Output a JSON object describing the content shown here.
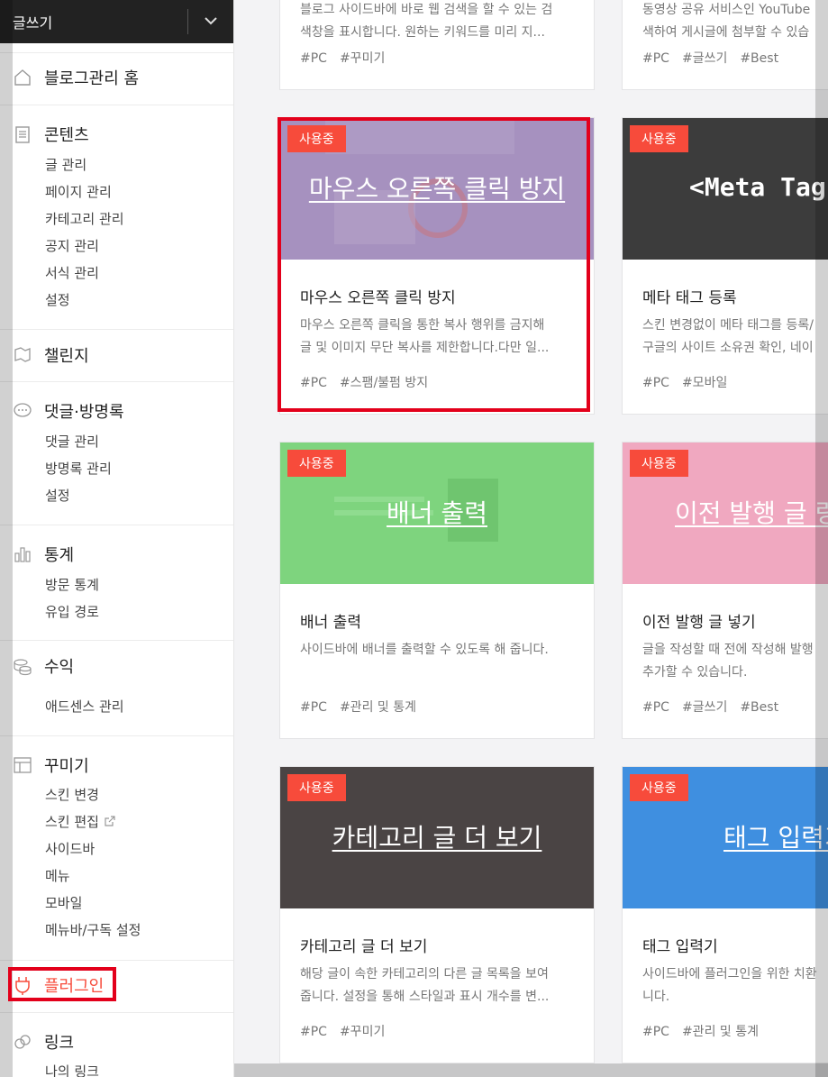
{
  "header": {
    "write_label": "글쓰기"
  },
  "sidebar": {
    "home": "블로그관리 홈",
    "contents": {
      "title": "콘텐츠",
      "items": [
        "글 관리",
        "페이지 관리",
        "카테고리 관리",
        "공지 관리",
        "서식 관리",
        "설정"
      ]
    },
    "challenge": "챌린지",
    "comments": {
      "title": "댓글·방명록",
      "items": [
        "댓글 관리",
        "방명록 관리",
        "설정"
      ]
    },
    "stats": {
      "title": "통계",
      "items": [
        "방문 통계",
        "유입 경로"
      ]
    },
    "revenue": {
      "title": "수익",
      "items": [
        "애드센스 관리"
      ]
    },
    "decorate": {
      "title": "꾸미기",
      "items": [
        "스킨 변경",
        "스킨 편집",
        "사이드바",
        "메뉴",
        "모바일",
        "메뉴바/구독 설정"
      ]
    },
    "plugin": "플러그인",
    "link": {
      "title": "링크",
      "items": [
        "나의 링크"
      ]
    }
  },
  "badge_label": "사용중",
  "cards": {
    "top_left": {
      "desc_line1": "블로그 사이드바에 바로 웹 검색을 할 수 있는 검",
      "desc_line2": "색창을 표시합니다. 원하는 키워드를 미리 지...",
      "tags": [
        "#PC",
        "#꾸미기"
      ]
    },
    "top_right": {
      "desc_line1": "동영상 공유 서비스인 YouTube",
      "desc_line2": "색하여 게시글에 첨부할 수 있습",
      "tags": [
        "#PC",
        "#글쓰기",
        "#Best"
      ]
    },
    "mouse": {
      "thumb": "마우스 오른쪽 클릭 방지",
      "title": "마우스 오른쪽 클릭 방지",
      "desc_line1": "마우스 오른쪽 클릭을 통한 복사 행위를 금지해",
      "desc_line2": "글 및 이미지 무단 복사를 제한합니다.다만 일...",
      "tags": [
        "#PC",
        "#스팸/불펌 방지"
      ]
    },
    "meta": {
      "thumb": "<Meta Tag",
      "title": "메타 태그 등록",
      "desc_line1": "스킨 변경없이 메타 태그를 등록/",
      "desc_line2": "구글의 사이트 소유권 확인, 네이",
      "tags": [
        "#PC",
        "#모바일"
      ]
    },
    "banner": {
      "thumb": "배너 출력",
      "title": "배너 출력",
      "desc_line1": "사이드바에 배너를 출력할 수 있도록 해 줍니다.",
      "tags": [
        "#PC",
        "#관리 및 통계"
      ]
    },
    "prev": {
      "thumb": "이전 발행 글 링크",
      "title": "이전 발행 글 넣기",
      "desc_line1": "글을 작성할 때 전에 작성해 발행",
      "desc_line2": "추가할 수 있습니다.",
      "tags": [
        "#PC",
        "#글쓰기",
        "#Best"
      ]
    },
    "category": {
      "thumb": "카테고리 글 더 보기",
      "title": "카테고리 글 더 보기",
      "desc_line1": "해당 글이 속한 카테고리의 다른 글 목록을 보여",
      "desc_line2": "줍니다. 설정을 통해 스타일과 표시 개수를 변...",
      "tags": [
        "#PC",
        "#꾸미기"
      ]
    },
    "tag": {
      "thumb": "태그 입력기",
      "title": "태그 입력기",
      "desc_line1": "사이드바에 플러그인을 위한 치환",
      "desc_line2": "니다.",
      "tags": [
        "#PC",
        "#관리 및 통계"
      ]
    }
  },
  "colors": {
    "accent": "#f74b3b",
    "highlight": "#e3001b",
    "mouse_thumb": "#a691bf",
    "meta_thumb": "#3c3c3c",
    "banner_thumb": "#7ed47e",
    "prev_thumb": "#f0a8c0",
    "category_thumb": "#4a4444",
    "tag_thumb": "#3f8fe0"
  }
}
